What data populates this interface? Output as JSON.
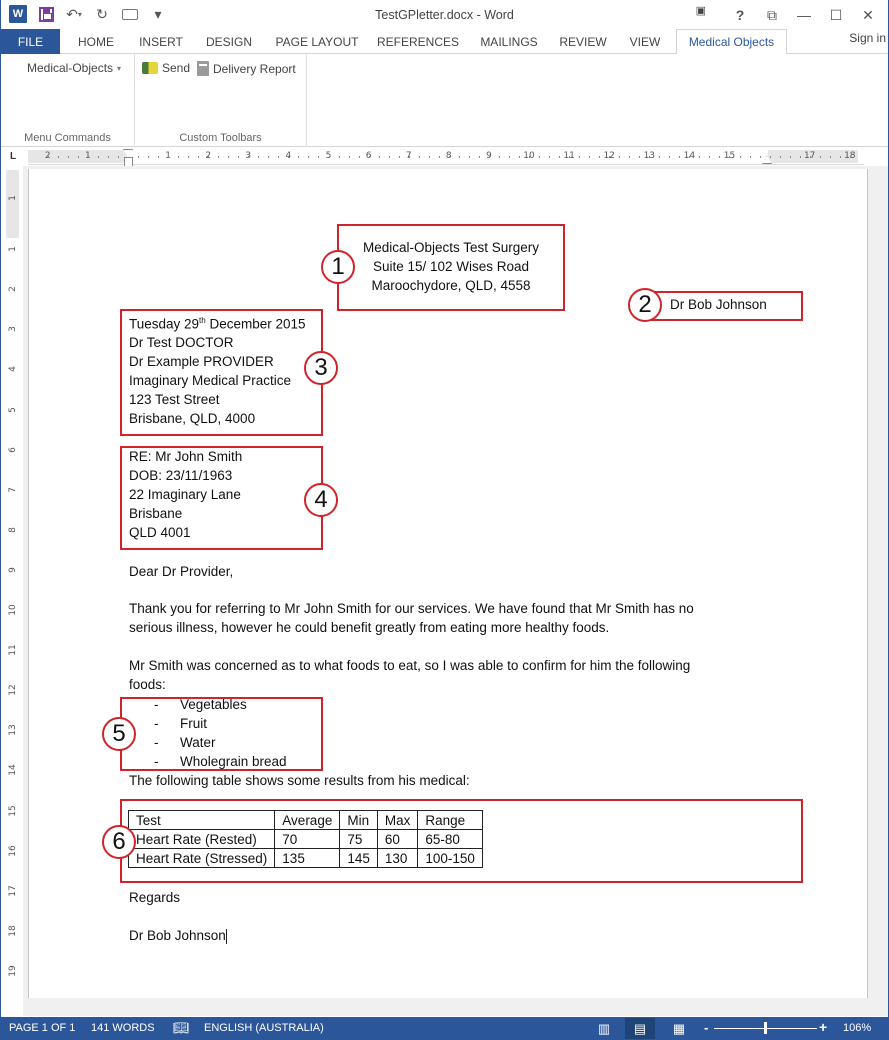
{
  "window": {
    "title": "TestGPletter.docx - Word",
    "controls": {
      "help": "?",
      "ribbon_display": "⧉",
      "minimize": "—",
      "maximize": "☐",
      "close": "✕"
    }
  },
  "quick_access": {
    "app_icon": "W",
    "items": [
      "word-logo-icon",
      "save-icon",
      "undo-icon",
      "redo-icon",
      "print-preview-icon",
      "customize-qat-icon"
    ]
  },
  "tabs": [
    {
      "label": "FILE"
    },
    {
      "label": "HOME"
    },
    {
      "label": "INSERT"
    },
    {
      "label": "DESIGN"
    },
    {
      "label": "PAGE LAYOUT"
    },
    {
      "label": "REFERENCES"
    },
    {
      "label": "MAILINGS"
    },
    {
      "label": "REVIEW"
    },
    {
      "label": "VIEW"
    },
    {
      "label": "Medical Objects",
      "active": true
    }
  ],
  "sign_in": "Sign in",
  "ribbon": {
    "groups": [
      {
        "label": "Menu Commands",
        "buttons": [
          {
            "label": "Medical-Objects",
            "dropdown": true
          }
        ]
      },
      {
        "label": "Custom Toolbars",
        "buttons": [
          {
            "label": "Send",
            "icon": "send-icon"
          },
          {
            "label": "Delivery Report",
            "icon": "delivery-report-icon"
          }
        ]
      }
    ]
  },
  "ruler": {
    "horizontal_left_ticks": [
      "2",
      "1"
    ],
    "horizontal_ticks": [
      "1",
      "2",
      "3",
      "4",
      "5",
      "6",
      "7",
      "8",
      "9",
      "10",
      "11",
      "12",
      "13",
      "14",
      "15",
      "16",
      "17",
      "18"
    ],
    "vertical_top_ticks": [
      "1"
    ],
    "vertical_ticks": [
      "1",
      "2",
      "3",
      "4",
      "5",
      "6",
      "7",
      "8",
      "9",
      "10",
      "11",
      "12",
      "13",
      "14",
      "15",
      "16",
      "17",
      "18",
      "19"
    ]
  },
  "document": {
    "callouts": [
      "1",
      "2",
      "3",
      "4",
      "5",
      "6"
    ],
    "sender_address": [
      "Medical-Objects Test Surgery",
      "Suite 15/ 102 Wises Road",
      "Maroochydore, QLD, 4558"
    ],
    "author": "Dr Bob Johnson",
    "recipient": {
      "date_prefix": "Tuesday 29",
      "date_sup": "th",
      "date_suffix": " December 2015",
      "lines": [
        "Dr Test DOCTOR",
        "Dr Example PROVIDER",
        "Imaginary Medical Practice",
        "123 Test Street",
        "Brisbane, QLD, 4000"
      ]
    },
    "patient": [
      "RE: Mr John Smith",
      "DOB: 23/11/1963",
      "22 Imaginary Lane",
      "Brisbane",
      "QLD 4001"
    ],
    "salutation": "Dear Dr Provider,",
    "paragraph1": [
      "Thank you for referring to Mr John Smith for our services. We have found that Mr Smith has no",
      "serious illness, however he could benefit greatly from eating more healthy foods."
    ],
    "paragraph2": [
      "Mr Smith was concerned as to what foods to eat, so I was able to confirm for him the following",
      "foods:"
    ],
    "list_bullet": "-",
    "foods": [
      "Vegetables",
      "Fruit",
      "Water",
      "Wholegrain bread"
    ],
    "table_intro": "The following table shows some results from his medical:",
    "table": {
      "headers": [
        "Test",
        "Average",
        "Min",
        "Max",
        "Range"
      ],
      "rows": [
        [
          "Heart Rate (Rested)",
          "70",
          "75",
          "60",
          "65-80"
        ],
        [
          "Heart Rate (Stressed)",
          "135",
          "145",
          "130",
          "100-150"
        ]
      ]
    },
    "closing": "Regards",
    "signature": "Dr Bob Johnson"
  },
  "status_bar": {
    "page": "PAGE 1 OF 1",
    "words": "141 WORDS",
    "language": "ENGLISH (AUSTRALIA)",
    "zoom_minus": "-",
    "zoom_plus": "+",
    "zoom": "106%"
  },
  "colors": {
    "accent": "#2b579a",
    "callout_red": "#d2232a"
  }
}
